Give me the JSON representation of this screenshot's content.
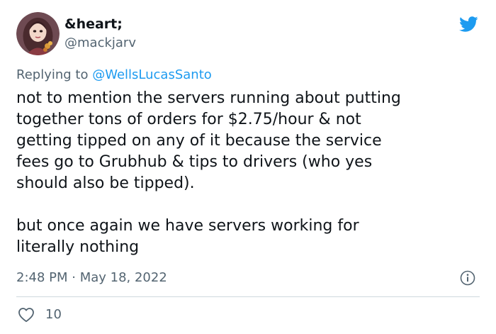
{
  "author": {
    "display_name": "&heart;",
    "handle": "@mackjarv"
  },
  "reply": {
    "prefix": "Replying to ",
    "mention": "@WellsLucasSanto"
  },
  "tweet": {
    "paragraphs": [
      "not to mention the servers running about putting\ntogether tons of orders for $2.75/hour & not\ngetting tipped on any of it because the service\nfees go to Grubhub & tips to drivers (who yes\nshould also be tipped).",
      "but once again we have servers working for\nliterally nothing"
    ],
    "timestamp": "2:48 PM · May 18, 2022"
  },
  "actions": {
    "like_count": "10"
  },
  "icons": {
    "platform": "twitter-bird-icon",
    "info": "info-icon",
    "like": "heart-icon"
  },
  "colors": {
    "accent": "#1d9bf0",
    "text": "#0f1419",
    "secondary": "#536471",
    "divider": "#cfd9de"
  }
}
